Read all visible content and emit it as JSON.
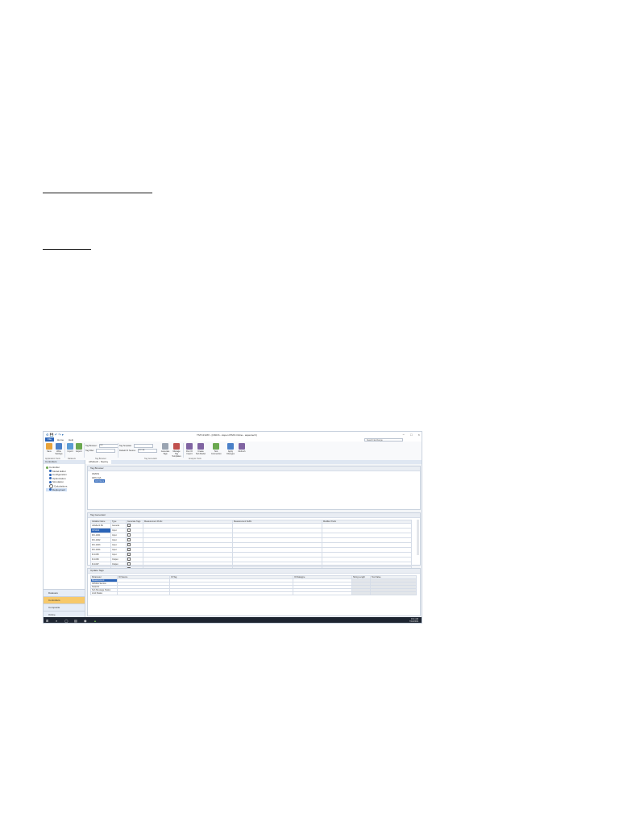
{
  "app": {
    "title": "TSTC1VMX - [OMCS - Aspen PIMS Online - aspentech]",
    "quick_access": "⚙ 💾 ↶ ↷ ▾",
    "window_controls": {
      "minimize": "−",
      "maximize": "□",
      "close": "×"
    }
  },
  "menu": {
    "file": "File",
    "home": "Home",
    "view": "Help"
  },
  "search": {
    "placeholder": "Search Exchange"
  },
  "ribbon": {
    "buttons": [
      {
        "label": "Save",
        "color": "#e8a33b"
      },
      {
        "label": "Write Settings",
        "color": "#4a80c8"
      },
      {
        "label": "Import",
        "color": "#5b9bd5"
      },
      {
        "label": "Export",
        "color": "#6aa84f"
      }
    ],
    "groups": {
      "g1": "Application Tools",
      "g2": "Datasets",
      "g3": "Tag Browser",
      "g4": "Tag Generator",
      "g5": "Analysis Tools"
    },
    "fields": {
      "tag_browser_label": "Tag Browser:",
      "tag_browser_value": "OPC",
      "tag_filter_label": "Tag Filter:",
      "tag_template_label": "Tag Template:",
      "default_sample_label": "Default IO Source:",
      "default_sample_value": "OPC DA"
    },
    "tools": [
      {
        "label": "Generate Tags",
        "color": "#9aa4b2"
      },
      {
        "label": "Manage Tag Templates",
        "color": "#c0504d"
      },
      {
        "label": "Run IO Import",
        "color": "#8064a2"
      },
      {
        "label": "Create Sub Model",
        "color": "#8064a2"
      },
      {
        "label": "Test Connection",
        "color": "#6aa84f"
      },
      {
        "label": "Apply Changes",
        "color": "#4a80c8"
      },
      {
        "label": "Refresh",
        "color": "#8064a2"
      }
    ]
  },
  "nav": {
    "header": "Controllers",
    "tree": [
      "Controller",
      "Model Editor",
      "Configuration",
      "Optimization",
      "Simulation",
      "Calculations",
      "Deployment"
    ],
    "groups": [
      "Datasets",
      "Controllers",
      "Composite",
      "Online"
    ]
  },
  "tab": {
    "label": "cdfa3ecb - Deploy"
  },
  "tag_browser": {
    "header": "Tag Browser",
    "items": [
      "OMCS",
      "OPC DA",
      "CFV101"
    ]
  },
  "tag_generator": {
    "header": "Tag Generator",
    "columns": [
      "Variable Name",
      "Type",
      "Generate Tags",
      "Measurement Prefix",
      "Measurement Suffix",
      "Modifier Prefix"
    ],
    "rows": [
      [
        "cdfa3ecb.B1",
        "General"
      ],
      [
        "CFV101",
        "Input"
      ],
      [
        "FIC-1001",
        "Input"
      ],
      [
        "FIC-1002",
        "Input"
      ],
      [
        "FIC-1003",
        "Input"
      ],
      [
        "FIC-1004",
        "Input"
      ],
      [
        "FI-1005",
        "Input"
      ],
      [
        "FI-1006",
        "Output"
      ],
      [
        "FI-1007",
        "Output"
      ],
      [
        "FI-1008",
        "Output"
      ],
      [
        "ARR001T",
        "Test Bench"
      ]
    ]
  },
  "update_tags": {
    "header": "Update Tags",
    "columns": [
      "Parameter",
      "IO Source",
      "IO Tag",
      "IO Datatype",
      "String Length",
      "Test Value"
    ],
    "rows": [
      "Measurement",
      "OPCDA Service",
      "Setpoint",
      "Sub Message Status",
      "Limit Status"
    ]
  },
  "taskbar": {
    "start": "⊞",
    "icons": [
      "⌕",
      "◯",
      "▤",
      "◉",
      "▲"
    ],
    "time": "9:11 AM",
    "date": "7/10/2019"
  }
}
